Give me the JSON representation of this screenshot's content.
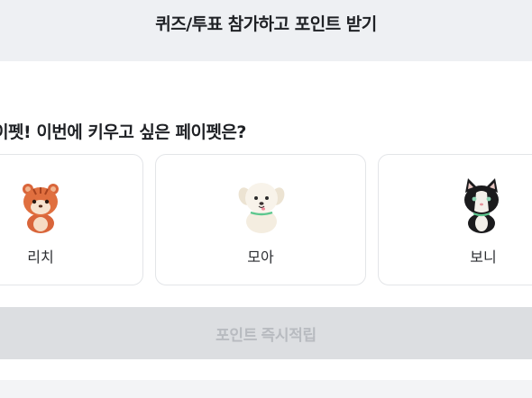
{
  "header": {
    "title": "퀴즈/투표 참가하고 포인트 받기"
  },
  "question": {
    "text": "진 페이펫! 이번에 키우고 싶은 페이펫은?"
  },
  "options": [
    {
      "label": "리치",
      "icon": "orange-tiger-pet-icon"
    },
    {
      "label": "모아",
      "icon": "white-puppy-pet-icon"
    },
    {
      "label": "보니",
      "icon": "black-cat-pet-icon"
    }
  ],
  "cta": {
    "label": "포인트 즉시적립",
    "state": "disabled"
  },
  "colors": {
    "background": "#eef0f3",
    "panel": "#ffffff",
    "card_border": "#e3e5e8",
    "cta_bg": "#dcdee1",
    "cta_text": "#b8bbc0"
  }
}
